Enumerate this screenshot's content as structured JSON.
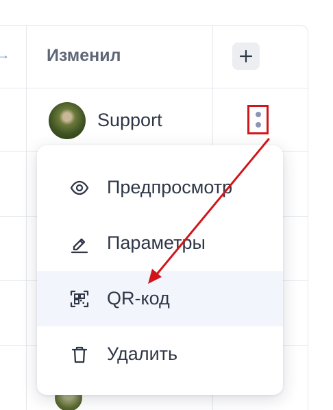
{
  "table": {
    "column_header": "Изменил",
    "add_column_label": "+",
    "row": {
      "user_name": "Support"
    }
  },
  "context_menu": {
    "items": [
      {
        "label": "Предпросмотр",
        "icon": "eye-icon"
      },
      {
        "label": "Параметры",
        "icon": "pencil-icon"
      },
      {
        "label": "QR-код",
        "icon": "qr-code-icon"
      },
      {
        "label": "Удалить",
        "icon": "trash-icon"
      }
    ],
    "highlighted_index": 2
  },
  "colors": {
    "annotation": "#d0161a",
    "menu_highlight": "#f2f5fb",
    "kebab_dots": "#8a96b3"
  }
}
